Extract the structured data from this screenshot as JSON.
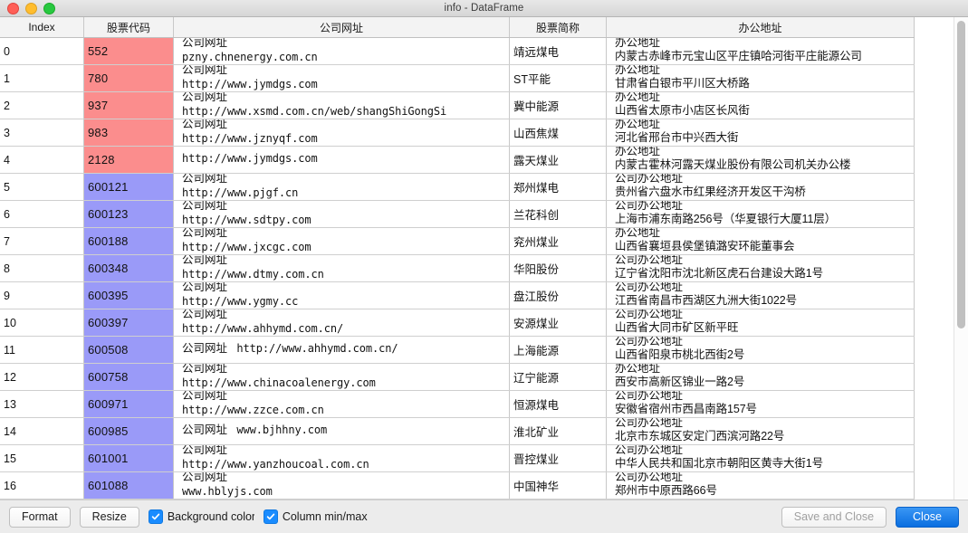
{
  "window": {
    "title": "info - DataFrame",
    "traffic_lights": [
      "close",
      "minimize",
      "zoom"
    ]
  },
  "table": {
    "columns": [
      "Index",
      "股票代码",
      "公司网址",
      "股票简称",
      "办公地址"
    ],
    "rows": [
      {
        "index": "0",
        "code": "552",
        "code_color": "red",
        "url_label": "公司网址",
        "url": "pzny.chnenergy.com.cn",
        "url_single": false,
        "name": "靖远煤电",
        "addr_label": "办公地址",
        "addr": "内蒙古赤峰市元宝山区平庄镇哈河街平庄能源公司"
      },
      {
        "index": "1",
        "code": "780",
        "code_color": "red",
        "url_label": "公司网址",
        "url": "http://www.jymdgs.com",
        "url_single": false,
        "name": "ST平能",
        "addr_label": "办公地址",
        "addr": "甘肃省白银市平川区大桥路"
      },
      {
        "index": "2",
        "code": "937",
        "code_color": "red",
        "url_label": "公司网址",
        "url": "http://www.xsmd.com.cn/web/shangShiGongSi",
        "url_single": false,
        "name": "冀中能源",
        "addr_label": "办公地址",
        "addr": "山西省太原市小店区长风街"
      },
      {
        "index": "3",
        "code": "983",
        "code_color": "red",
        "url_label": "公司网址",
        "url": "http://www.jznyqf.com",
        "url_single": false,
        "name": "山西焦煤",
        "addr_label": "办公地址",
        "addr": "河北省邢台市中兴西大街"
      },
      {
        "index": "4",
        "code": "2128",
        "code_color": "red",
        "url_label": "",
        "url": "http://www.jymdgs.com",
        "url_single": true,
        "name": "露天煤业",
        "addr_label": "办公地址",
        "addr": "内蒙古霍林河露天煤业股份有限公司机关办公楼"
      },
      {
        "index": "5",
        "code": "600121",
        "code_color": "blue",
        "url_label": "公司网址",
        "url": "http://www.pjgf.cn",
        "url_single": false,
        "name": "郑州煤电",
        "addr_label": "公司办公地址",
        "addr": "贵州省六盘水市红果经济开发区干沟桥"
      },
      {
        "index": "6",
        "code": "600123",
        "code_color": "blue",
        "url_label": "公司网址",
        "url": "http://www.sdtpy.com",
        "url_single": false,
        "name": "兰花科创",
        "addr_label": "公司办公地址",
        "addr": "上海市浦东南路256号（华夏银行大厦11层）"
      },
      {
        "index": "7",
        "code": "600188",
        "code_color": "blue",
        "url_label": "公司网址",
        "url": "http://www.jxcgc.com",
        "url_single": false,
        "name": "兖州煤业",
        "addr_label": "办公地址",
        "addr": "山西省襄垣县侯堡镇潞安环能董事会"
      },
      {
        "index": "8",
        "code": "600348",
        "code_color": "blue",
        "url_label": "公司网址",
        "url": "http://www.dtmy.com.cn",
        "url_single": false,
        "name": "华阳股份",
        "addr_label": "公司办公地址",
        "addr": "辽宁省沈阳市沈北新区虎石台建设大路1号"
      },
      {
        "index": "9",
        "code": "600395",
        "code_color": "blue",
        "url_label": "公司网址",
        "url": "http://www.ygmy.cc",
        "url_single": false,
        "name": "盘江股份",
        "addr_label": "公司办公地址",
        "addr": "江西省南昌市西湖区九洲大街1022号"
      },
      {
        "index": "10",
        "code": "600397",
        "code_color": "blue",
        "url_label": "公司网址",
        "url": "http://www.ahhymd.com.cn/",
        "url_single": false,
        "name": "安源煤业",
        "addr_label": "公司办公地址",
        "addr": "山西省大同市矿区新平旺"
      },
      {
        "index": "11",
        "code": "600508",
        "code_color": "blue",
        "url_label": "公司网址",
        "url": "http://www.ahhymd.com.cn/",
        "url_single": true,
        "name": "上海能源",
        "addr_label": "公司办公地址",
        "addr": "山西省阳泉市桃北西街2号"
      },
      {
        "index": "12",
        "code": "600758",
        "code_color": "blue",
        "url_label": "公司网址",
        "url": "http://www.chinacoalenergy.com",
        "url_single": false,
        "name": "辽宁能源",
        "addr_label": "办公地址",
        "addr": "西安市高新区锦业一路2号"
      },
      {
        "index": "13",
        "code": "600971",
        "code_color": "blue",
        "url_label": "公司网址",
        "url": "http://www.zzce.com.cn",
        "url_single": false,
        "name": "恒源煤电",
        "addr_label": "公司办公地址",
        "addr": "安徽省宿州市西昌南路157号"
      },
      {
        "index": "14",
        "code": "600985",
        "code_color": "blue",
        "url_label": "公司网址",
        "url": "www.bjhhny.com",
        "url_single": true,
        "name": "淮北矿业",
        "addr_label": "公司办公地址",
        "addr": "北京市东城区安定门西滨河路22号"
      },
      {
        "index": "15",
        "code": "601001",
        "code_color": "blue",
        "url_label": "公司网址",
        "url": "http://www.yanzhoucoal.com.cn",
        "url_single": false,
        "name": "晋控煤业",
        "addr_label": "公司办公地址",
        "addr": "中华人民共和国北京市朝阳区黄寺大街1号"
      },
      {
        "index": "16",
        "code": "601088",
        "code_color": "blue",
        "url_label": "公司网址",
        "url": "www.hblyjs.com",
        "url_single": false,
        "name": "中国神华",
        "addr_label": "公司办公地址",
        "addr": "郑州市中原西路66号"
      }
    ]
  },
  "toolbar": {
    "format_label": "Format",
    "resize_label": "Resize",
    "background_color_label": "Background color",
    "column_minmax_label": "Column min/max",
    "background_color_checked": true,
    "column_minmax_checked": true,
    "save_and_close_label": "Save and Close",
    "close_label": "Close"
  },
  "colors": {
    "code_red": "#fb8d8d",
    "code_blue": "#9a9af8",
    "primary_button": "#0a6ee0",
    "checkbox": "#1a8cff"
  }
}
